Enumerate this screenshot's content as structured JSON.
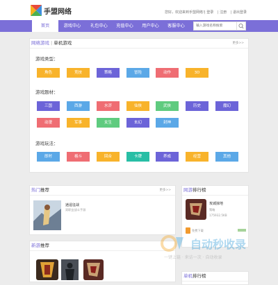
{
  "header": {
    "logo_text": "手盟网络",
    "welcome": "您好，欢迎来到手盟网络！",
    "links": [
      "| 登录",
      "| 注册",
      "| 退出登录"
    ]
  },
  "nav": {
    "items": [
      "首页",
      "游戏中心",
      "礼包中心",
      "充值中心",
      "用户中心",
      "客服中心"
    ],
    "search_placeholder": "输入游戏名称搜索"
  },
  "filter": {
    "tab_network": "网络游戏",
    "tab_single": "单机游戏",
    "more": "更多>>",
    "type_title": "游戏类型：",
    "types": [
      "角色",
      "竞技",
      "策略",
      "冒险",
      "动作",
      "3D"
    ],
    "theme_title": "游戏题材：",
    "themes_row1": [
      "三国",
      "西游",
      "水浒",
      "仙侠",
      "武侠",
      "历史",
      "魔幻"
    ],
    "themes_row2": [
      "动漫",
      "军事",
      "女生",
      "玄幻",
      "封神"
    ],
    "play_title": "游戏玩法：",
    "plays": [
      "即时",
      "格斗",
      "回合",
      "卡牌",
      "养成",
      "经营",
      "其他"
    ]
  },
  "hot": {
    "title_accent": "热门",
    "title_rest": "推荐",
    "more": "更多>>",
    "item_title": "逍遥征战",
    "item_desc": "双职业战斗手游"
  },
  "ranking": {
    "title_accent": "网游",
    "title_rest": "排行榜",
    "item_title": "攻城掠地",
    "item_cat": "策略",
    "item_size": "175932.5KB",
    "item_label": "免费下载"
  },
  "newgame": {
    "title_accent": "新游",
    "title_rest": "推荐"
  },
  "ranking2": {
    "title_accent": "单机",
    "title_rest": "排行榜"
  },
  "watermark": {
    "brand": "自动秒收录",
    "slogan": "一键上链 · 来访一次 · 自动收录"
  },
  "colors": {
    "accent": "#7b6fd8",
    "orange": "#f8b32b",
    "green": "#5fcb7f",
    "purple": "#6c64d8",
    "blue": "#5ba8e7",
    "pink": "#ef6d73",
    "teal": "#28bea5"
  }
}
